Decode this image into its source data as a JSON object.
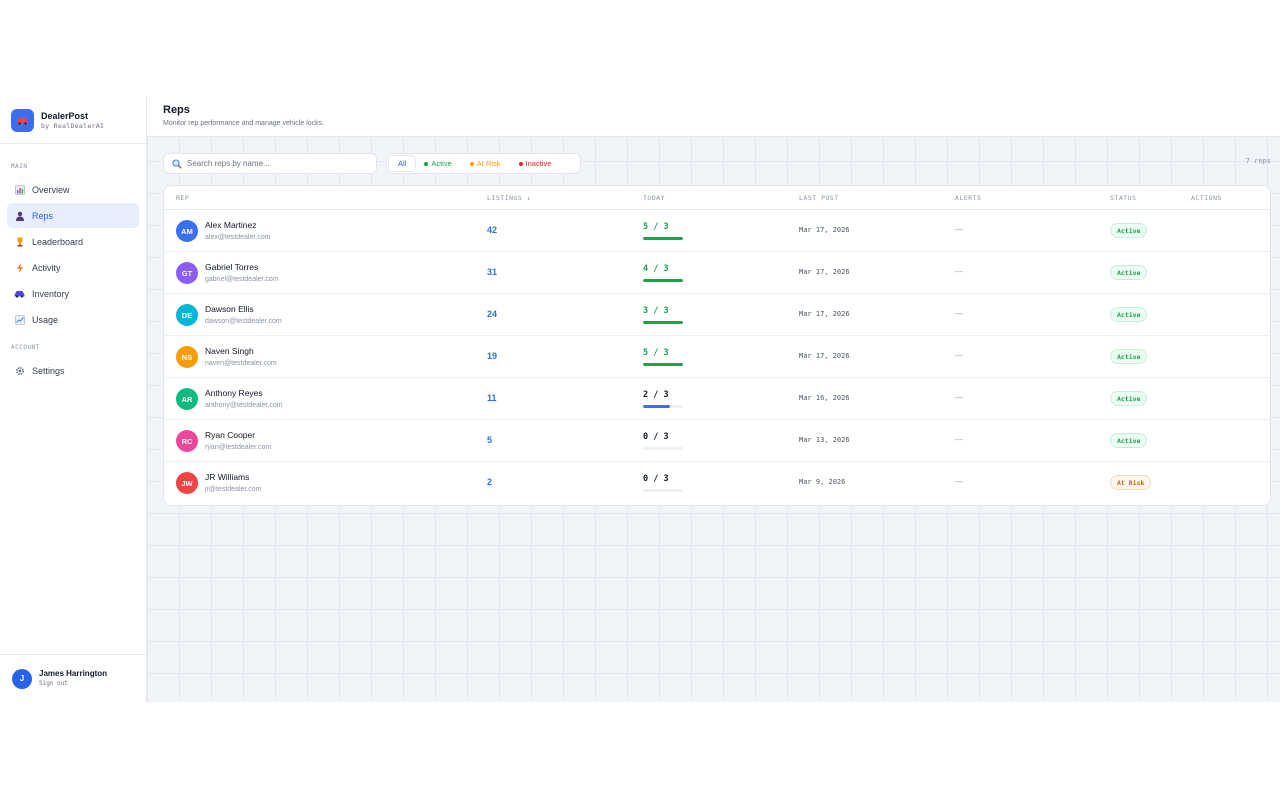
{
  "brand": {
    "name": "DealerPost",
    "sub": "by RealDealerAI"
  },
  "sidebar": {
    "main_label": "MAIN",
    "account_label": "ACCOUNT",
    "main_items": [
      {
        "label": "Overview",
        "icon": "chart-icon",
        "active": false
      },
      {
        "label": "Reps",
        "icon": "person-icon",
        "active": true
      },
      {
        "label": "Leaderboard",
        "icon": "trophy-icon",
        "active": false
      },
      {
        "label": "Activity",
        "icon": "lightning-icon",
        "active": false
      },
      {
        "label": "Inventory",
        "icon": "car-icon",
        "active": false
      },
      {
        "label": "Usage",
        "icon": "trend-icon",
        "active": false
      }
    ],
    "account_items": [
      {
        "label": "Settings",
        "icon": "gear-icon",
        "active": false
      }
    ],
    "user": {
      "initial": "J",
      "name": "James Harrington",
      "signout": "Sign out"
    }
  },
  "header": {
    "title": "Reps",
    "subtitle": "Monitor rep performance and manage vehicle locks."
  },
  "search": {
    "placeholder": "Search reps by name..."
  },
  "filters": [
    {
      "label": "All",
      "color": "#2563eb",
      "dot": false
    },
    {
      "label": "Active",
      "color": "#16a34a",
      "dot": true
    },
    {
      "label": "At Risk",
      "color": "#f59e0b",
      "dot": true
    },
    {
      "label": "Inactive",
      "color": "#dc2626",
      "dot": true
    }
  ],
  "rep_count": "7 reps",
  "table": {
    "columns": {
      "rep": "REP",
      "listings": "LISTINGS ↓",
      "today": "TODAY",
      "last_post": "LAST POST",
      "alerts": "ALERTS",
      "status": "STATUS",
      "actions": "ACTIONS"
    },
    "rows": [
      {
        "initials": "AM",
        "avatar_color": "#3b6ef0",
        "name": "Alex Martinez",
        "email": "alex@testdealer.com",
        "listings": "42",
        "today": "5 / 3",
        "today_progress": 1.0,
        "today_color": "#16a34a",
        "last_post": "Mar 17, 2026",
        "alerts": "—",
        "status": "Active",
        "status_type": "active"
      },
      {
        "initials": "GT",
        "avatar_color": "#8b5cf6",
        "name": "Gabriel Torres",
        "email": "gabriel@testdealer.com",
        "listings": "31",
        "today": "4 / 3",
        "today_progress": 1.0,
        "today_color": "#16a34a",
        "last_post": "Mar 17, 2026",
        "alerts": "—",
        "status": "Active",
        "status_type": "active"
      },
      {
        "initials": "DE",
        "avatar_color": "#06b6d4",
        "name": "Dawson Ellis",
        "email": "dawson@testdealer.com",
        "listings": "24",
        "today": "3 / 3",
        "today_progress": 1.0,
        "today_color": "#16a34a",
        "last_post": "Mar 17, 2026",
        "alerts": "—",
        "status": "Active",
        "status_type": "active"
      },
      {
        "initials": "NS",
        "avatar_color": "#f59e0b",
        "name": "Naven Singh",
        "email": "naven@testdealer.com",
        "listings": "19",
        "today": "5 / 3",
        "today_progress": 1.0,
        "today_color": "#16a34a",
        "last_post": "Mar 17, 2026",
        "alerts": "—",
        "status": "Active",
        "status_type": "active"
      },
      {
        "initials": "AR",
        "avatar_color": "#10b981",
        "name": "Anthony Reyes",
        "email": "anthony@testdealer.com",
        "listings": "11",
        "today": "2 / 3",
        "today_progress": 0.67,
        "today_color": "#111827",
        "bar_color": "#3b6ef0",
        "last_post": "Mar 16, 2026",
        "alerts": "—",
        "status": "Active",
        "status_type": "active"
      },
      {
        "initials": "RC",
        "avatar_color": "#ec4899",
        "name": "Ryan Cooper",
        "email": "ryan@testdealer.com",
        "listings": "5",
        "today": "0 / 3",
        "today_progress": 0,
        "today_color": "#111827",
        "last_post": "Mar 13, 2026",
        "alerts": "—",
        "status": "Active",
        "status_type": "active"
      },
      {
        "initials": "JW",
        "avatar_color": "#ef4444",
        "name": "JR Williams",
        "email": "jr@testdealer.com",
        "listings": "2",
        "today": "0 / 3",
        "today_progress": 0,
        "today_color": "#111827",
        "last_post": "Mar 9, 2026",
        "alerts": "—",
        "status": "At Risk",
        "status_type": "risk"
      }
    ]
  }
}
